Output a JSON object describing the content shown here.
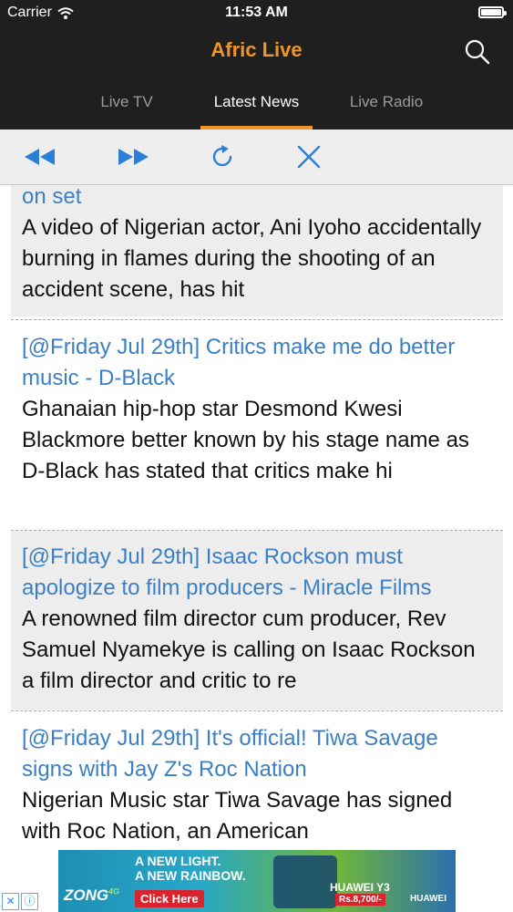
{
  "status_bar": {
    "carrier": "Carrier",
    "time": "11:53 AM"
  },
  "header": {
    "title": "Afric Live"
  },
  "tabs": [
    {
      "label": "Live TV",
      "active": false
    },
    {
      "label": "Latest News",
      "active": true
    },
    {
      "label": "Live Radio",
      "active": false
    }
  ],
  "toolbar": {
    "back_icon": "rewind-icon",
    "forward_icon": "fast-forward-icon",
    "refresh_icon": "refresh-icon",
    "close_icon": "close-icon"
  },
  "colors": {
    "accent": "#f0952a",
    "link": "#3b7fc4",
    "header_bg": "#1f1f1f",
    "toolbar_icon": "#2b7fd6"
  },
  "news": [
    {
      "title": "on set",
      "body": "A video of Nigerian actor, Ani Iyoho accidentally burning in flames during the shooting of an accident scene, has hit"
    },
    {
      "title": "[@Friday Jul 29th] Critics make me do better music - D-Black",
      "body": "Ghanaian hip-hop star Desmond Kwesi Blackmore better known by his stage name as D-Black has stated that critics make hi"
    },
    {
      "title": "[@Friday Jul 29th] Isaac Rockson must apologize to film producers - Miracle Films",
      "body": "A renowned film director cum producer, Rev Samuel Nyamekye is calling on Isaac Rockson a film director and critic to re"
    },
    {
      "title": "[@Friday Jul 29th] It's official! Tiwa Savage signs with Jay Z's Roc Nation",
      "body": "Nigerian Music star Tiwa Savage has signed with Roc Nation, an American"
    }
  ],
  "ad": {
    "headline_1": "A NEW LIGHT.",
    "headline_2": "A NEW RAINBOW.",
    "brand": "ZONG",
    "brand_suffix": "4G",
    "cta": "Click Here",
    "product": "HUAWEI Y3",
    "price": "Rs.8,700/-",
    "maker": "HUAWEI"
  }
}
